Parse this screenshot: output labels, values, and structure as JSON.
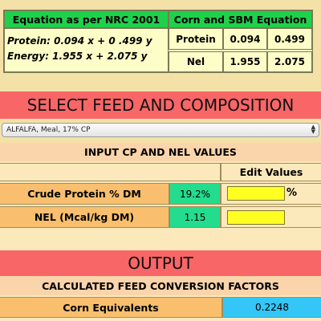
{
  "equation_box": {
    "title_left": "Equation as per NRC 2001",
    "title_right": "Corn and SBM Equation",
    "protein_equation": "Protein: 0.094 x  +  0 .499 y",
    "energy_equation": "Energy: 1.955 x + 2.075 y",
    "rows": [
      {
        "label": "Protein",
        "x": "0.094",
        "y": "0.499"
      },
      {
        "label": "Nel",
        "x": "1.955",
        "y": "2.075"
      }
    ]
  },
  "select_section": {
    "title": "SELECT FEED AND COMPOSITION",
    "feed_selected": "ALFALFA, Meal, 17% CP"
  },
  "input_section": {
    "title": "INPUT CP AND NEL VALUES",
    "edit_header": "Edit Values",
    "rows": [
      {
        "label": "Crude Protein % DM",
        "value": "19.2%",
        "edit_value": "",
        "unit": "%"
      },
      {
        "label": "NEL (Mcal/kg DM)",
        "value": "1.15",
        "edit_value": "",
        "unit": ""
      }
    ]
  },
  "output_section": {
    "title": "OUTPUT",
    "subtitle": "CALCULATED FEED CONVERSION FACTORS",
    "rows": [
      {
        "label": "Corn Equivalents",
        "value": "0.2248"
      }
    ]
  },
  "colors": {
    "header_green": "#1fd14a",
    "banner_red": "#f86667",
    "label_orange": "#f9bf6e",
    "value_green": "#23dc8d",
    "input_yellow": "#ffff22",
    "output_blue": "#33c6f7"
  },
  "icons": {
    "dropdown": "select-arrows-icon"
  }
}
